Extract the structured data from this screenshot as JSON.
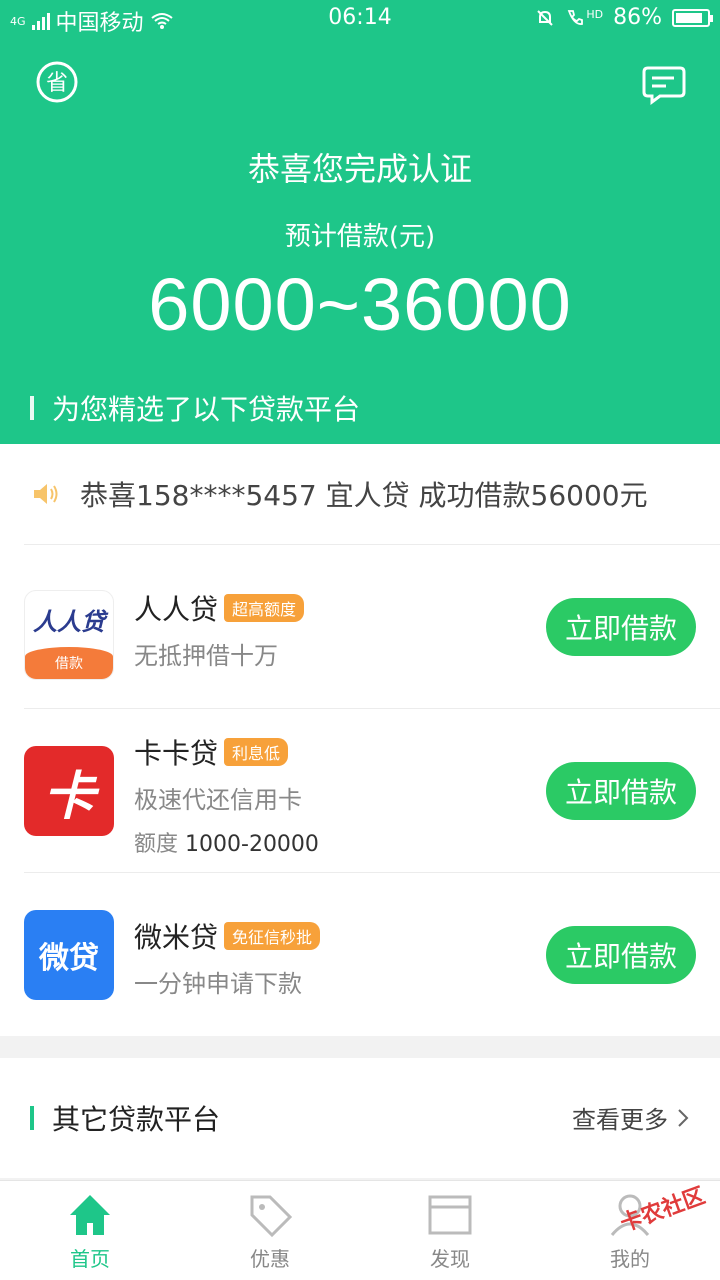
{
  "status_bar": {
    "carrier": "中国移动",
    "network": "4G",
    "time": "06:14",
    "hd": "HD",
    "battery": "86%",
    "battery_level": 0.86
  },
  "hero": {
    "title": "恭喜您完成认证",
    "subtitle": "预计借款(元)",
    "amount": "6000~36000",
    "section_title": "为您精选了以下贷款平台",
    "left_icon": "save-badge-icon",
    "right_icon": "message-icon"
  },
  "notice": {
    "text": "恭喜158****5457 宜人贷 成功借款56000元"
  },
  "products": [
    {
      "name": "人人贷",
      "tag": "超高额度",
      "desc": "无抵押借十万",
      "limit_label": "",
      "limit_value": "",
      "logo_text": "人人贷",
      "logo_badge": "借款",
      "button": "立即借款"
    },
    {
      "name": "卡卡贷",
      "tag": "利息低",
      "desc": "极速代还信用卡",
      "limit_label": "额度",
      "limit_value": "1000-20000",
      "logo_text": "卡",
      "button": "立即借款"
    },
    {
      "name": "微米贷",
      "tag": "免征信秒批",
      "desc": "一分钟申请下款",
      "limit_label": "",
      "limit_value": "",
      "logo_text": "微贷",
      "button": "立即借款"
    }
  ],
  "others": {
    "title": "其它贷款平台",
    "more": "查看更多"
  },
  "tabs": [
    {
      "label": "首页",
      "icon": "home-icon"
    },
    {
      "label": "优惠",
      "icon": "tag-icon"
    },
    {
      "label": "发现",
      "icon": "window-icon"
    },
    {
      "label": "我的",
      "icon": "user-icon"
    }
  ],
  "watermark": "卡农社区",
  "colors": {
    "primary": "#1ec689",
    "button": "#2bca65",
    "tag": "#f7a13a"
  }
}
